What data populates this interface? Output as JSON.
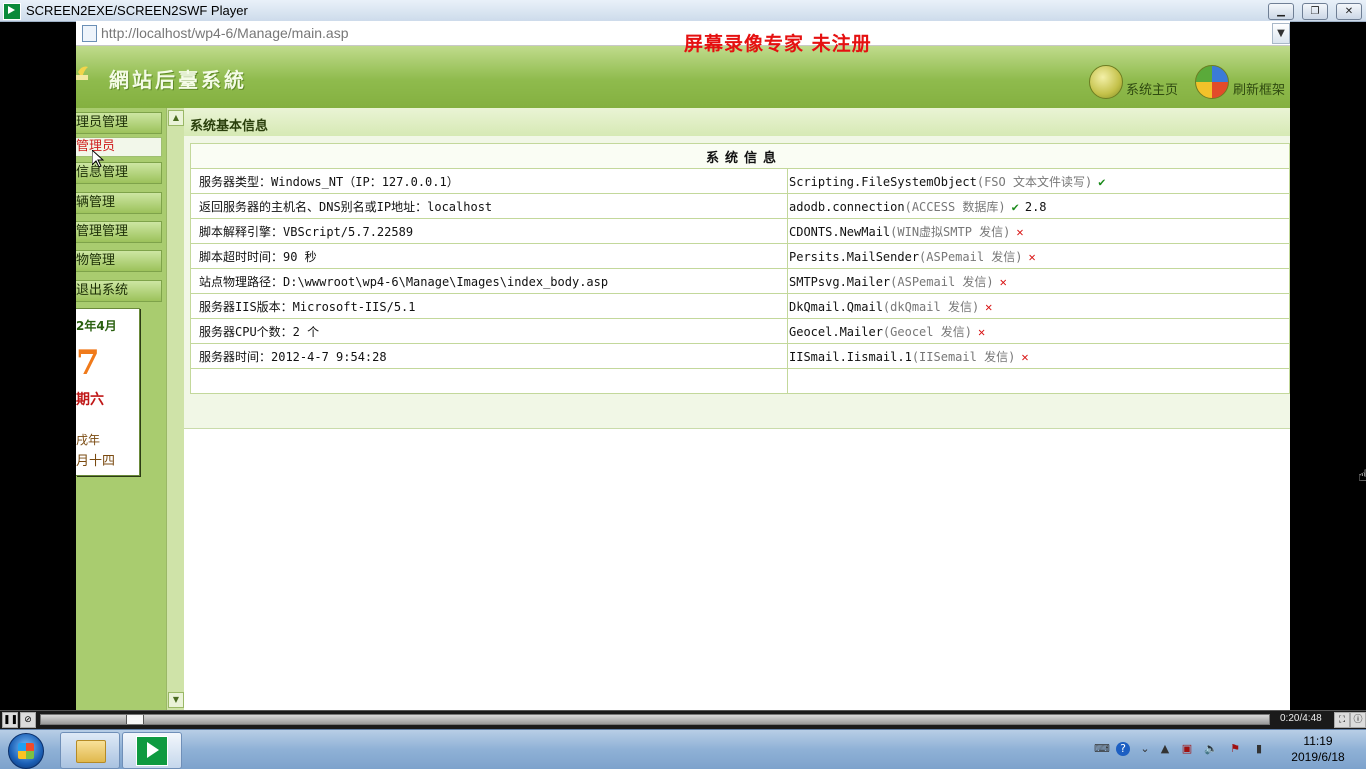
{
  "window": {
    "title": "SCREEN2EXE/SCREEN2SWF Player"
  },
  "browser": {
    "url": "http://localhost/wp4-6/Manage/main.asp"
  },
  "watermark": "屏幕录像专家  未注册",
  "header": {
    "logo_text": "網站后臺系統",
    "home_label": "系统主页",
    "refresh_label": "刷新框架"
  },
  "sidebar": {
    "items": [
      {
        "label": "理员管理"
      },
      {
        "label": "管理员"
      },
      {
        "label": "信息管理"
      },
      {
        "label": "辆管理"
      },
      {
        "label": "管理管理"
      },
      {
        "label": "物管理"
      },
      {
        "label": "退出系统"
      }
    ],
    "calendar": {
      "year_month": "2年4月",
      "day": "7",
      "weekday": "期六",
      "ganzhi": "戌年",
      "lunar": "月十四"
    }
  },
  "main": {
    "section_title": "系统基本信息",
    "table_header": "系统信息",
    "rows": [
      {
        "left": "服务器类型：Windows_NT（IP：127.0.0.1）",
        "comp": "Scripting.FileSystemObject",
        "desc": "(FSO 文本文件读写)",
        "status": "ok",
        "version": ""
      },
      {
        "left": "返回服务器的主机名、DNS别名或IP地址：localhost",
        "comp": "adodb.connection",
        "desc": "(ACCESS 数据库)",
        "status": "ok",
        "version": "2.8"
      },
      {
        "left": "脚本解释引擎：VBScript/5.7.22589",
        "comp": "CDONTS.NewMail",
        "desc": "(WIN虚拟SMTP 发信)",
        "status": "no",
        "version": ""
      },
      {
        "left": "脚本超时时间：90 秒",
        "comp": "Persits.MailSender",
        "desc": "(ASPemail 发信)",
        "status": "no",
        "version": ""
      },
      {
        "left": "站点物理路径：D:\\wwwroot\\wp4-6\\Manage\\Images\\index_body.asp",
        "comp": "SMTPsvg.Mailer",
        "desc": "(ASPemail 发信)",
        "status": "no",
        "version": ""
      },
      {
        "left": "服务器IIS版本：Microsoft-IIS/5.1",
        "comp": "DkQmail.Qmail",
        "desc": "(dkQmail 发信)",
        "status": "no",
        "version": ""
      },
      {
        "left": "服务器CPU个数：2 个",
        "comp": "Geocel.Mailer",
        "desc": "(Geocel 发信)",
        "status": "no",
        "version": ""
      },
      {
        "left": "服务器时间：2012-4-7 9:54:28",
        "comp": "IISmail.Iismail.1",
        "desc": "(IISemail 发信)",
        "status": "no",
        "version": ""
      }
    ],
    "status_glyphs": {
      "ok": "✔",
      "no": "✕"
    }
  },
  "player": {
    "time": "0:20/4:48",
    "progress": 0.07
  },
  "taskbar": {
    "clock_time": "11:19",
    "clock_date": "2019/6/18"
  },
  "icons": [
    "app-icon",
    "minimize-icon",
    "maximize-icon",
    "close-icon",
    "page-icon",
    "dropdown-icon",
    "home-icon",
    "refresh-icon",
    "pause-icon",
    "stop-icon",
    "fullscreen-icon",
    "info-icon",
    "start-orb-icon",
    "folder-icon",
    "speaker-icon",
    "network-icon"
  ],
  "colors": {
    "header_green": "#8fbb4d",
    "watermark_red": "#e51010",
    "ok_green": "#1a8a1a",
    "error_red": "#d81010"
  }
}
